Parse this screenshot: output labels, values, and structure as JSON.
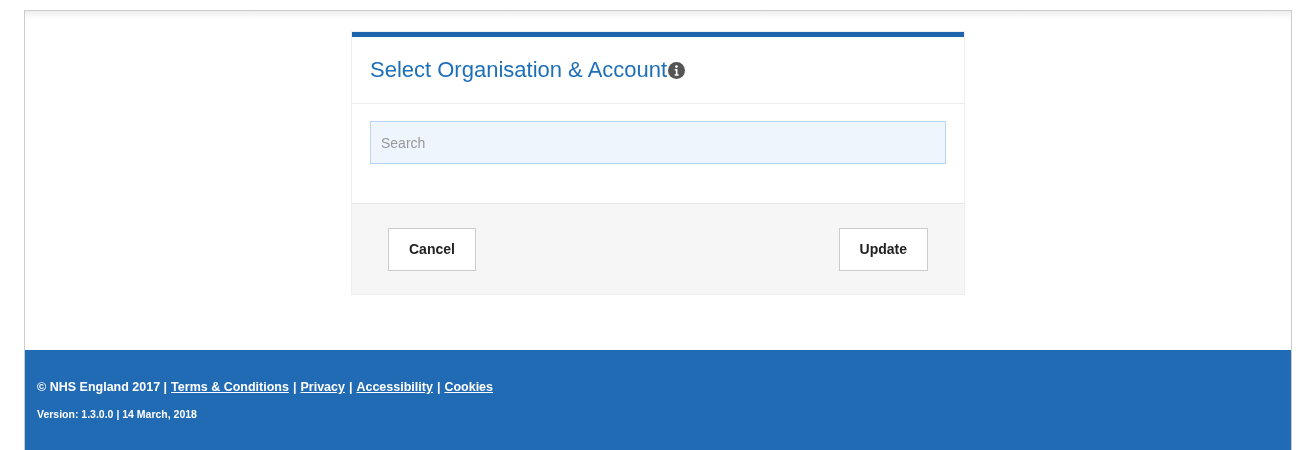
{
  "dialog": {
    "title": "Select Organisation & Account",
    "search": {
      "placeholder": "Search"
    },
    "buttons": [
      {
        "label": "Cancel"
      },
      {
        "label": "Update"
      }
    ]
  },
  "footer": {
    "line": [
      {
        "kind": "text",
        "text": "© NHS England 2017 |"
      },
      {
        "kind": "link",
        "text": "Terms & Conditions"
      },
      {
        "kind": "text",
        "text": "|"
      },
      {
        "kind": "link",
        "text": "Privacy"
      },
      {
        "kind": "text",
        "text": "|"
      },
      {
        "kind": "link",
        "text": "Accessibility"
      },
      {
        "kind": "text",
        "text": "|"
      },
      {
        "kind": "link",
        "text": "Cookies"
      }
    ],
    "version": "Version: 1.3.0.0 | 14 March, 2018"
  }
}
